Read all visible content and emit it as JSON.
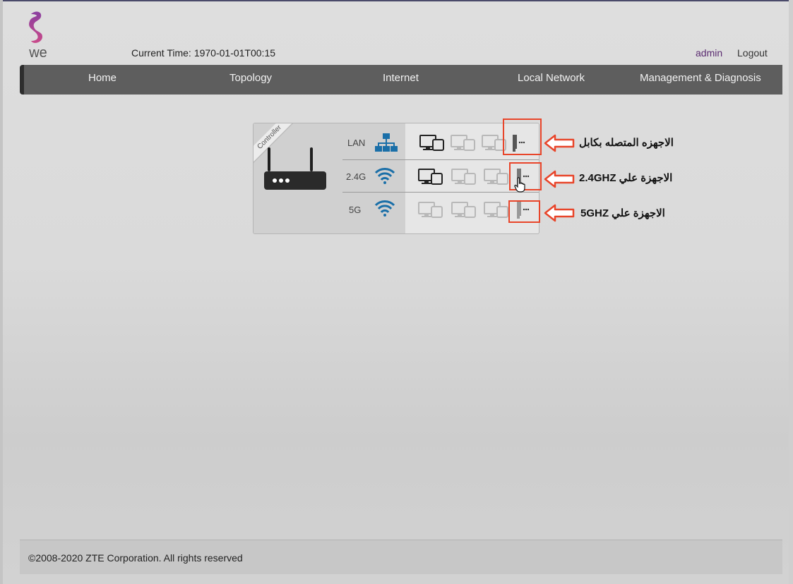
{
  "header": {
    "brand": "we",
    "current_time_label": "Current Time:",
    "current_time_value": "1970-01-01T00:15",
    "admin": "admin",
    "logout": "Logout"
  },
  "nav": {
    "items": [
      "Home",
      "Topology",
      "Internet",
      "Local Network",
      "Management & Diagnosis"
    ]
  },
  "topology": {
    "ribbon": "Controller",
    "bands": [
      {
        "label": "LAN",
        "icon": "lan-network-icon"
      },
      {
        "label": "2.4G",
        "icon": "wifi-icon"
      },
      {
        "label": "5G",
        "icon": "wifi-icon"
      }
    ],
    "icon_color": "#1a6fa8"
  },
  "annotations": [
    "الاجهزه المتصله بكابل",
    "الاجهزة علي 2.4GHZ",
    "الاجهزة علي 5GHZ"
  ],
  "footer": {
    "copyright": "©2008-2020 ZTE Corporation. All rights reserved"
  },
  "colors": {
    "navbar": "#5e5e5e",
    "annotation_red": "#e8452a",
    "brand_purple": "#6a2c8c"
  }
}
